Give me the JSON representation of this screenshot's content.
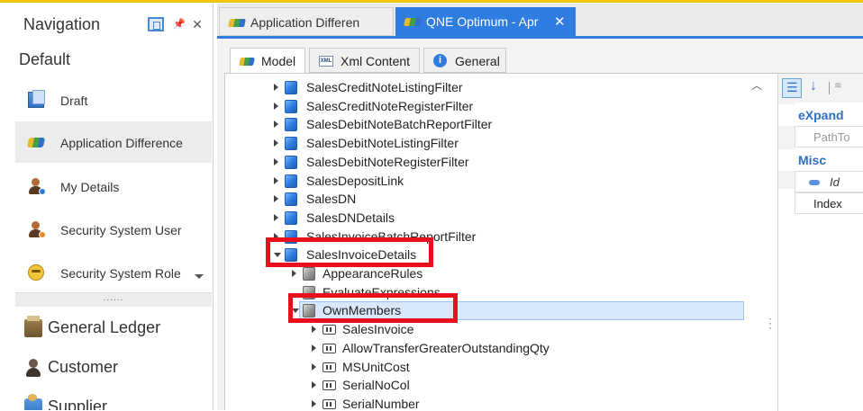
{
  "navigation": {
    "title": "Navigation",
    "group": "Default",
    "items": [
      {
        "label": "Draft",
        "icon": "draft-icon"
      },
      {
        "label": "Application Difference",
        "icon": "application-difference-icon",
        "selected": true
      },
      {
        "label": "My Details",
        "icon": "my-details-icon"
      },
      {
        "label": "Security System User",
        "icon": "security-user-icon"
      },
      {
        "label": "Security System Role",
        "icon": "security-role-icon"
      }
    ],
    "splitter": "......",
    "modules": [
      {
        "label": "General Ledger",
        "icon": "general-ledger-icon"
      },
      {
        "label": "Customer",
        "icon": "customer-icon"
      },
      {
        "label": "Supplier",
        "icon": "supplier-icon"
      }
    ]
  },
  "document_tabs": [
    {
      "label": "Application Differen",
      "active": false
    },
    {
      "label": "QNE Optimum - Apr",
      "active": true,
      "close": "✕"
    }
  ],
  "inner_tabs": [
    {
      "label": "Model",
      "selected": true
    },
    {
      "label": "Xml Content",
      "selected": false
    },
    {
      "label": "General",
      "selected": false
    }
  ],
  "tree": [
    {
      "label": "SalesCreditNoteListingFilter",
      "level": 0,
      "arrow": "right",
      "icon": "cube-blue"
    },
    {
      "label": "SalesCreditNoteRegisterFilter",
      "level": 0,
      "arrow": "right",
      "icon": "cube-blue"
    },
    {
      "label": "SalesDebitNoteBatchReportFilter",
      "level": 0,
      "arrow": "right",
      "icon": "cube-blue"
    },
    {
      "label": "SalesDebitNoteListingFilter",
      "level": 0,
      "arrow": "right",
      "icon": "cube-blue"
    },
    {
      "label": "SalesDebitNoteRegisterFilter",
      "level": 0,
      "arrow": "right",
      "icon": "cube-blue"
    },
    {
      "label": "SalesDepositLink",
      "level": 0,
      "arrow": "right",
      "icon": "cube-blue"
    },
    {
      "label": "SalesDN",
      "level": 0,
      "arrow": "right",
      "icon": "cube-blue"
    },
    {
      "label": "SalesDNDetails",
      "level": 0,
      "arrow": "right",
      "icon": "cube-blue"
    },
    {
      "label": "SalesInvoiceBatchReportFilter",
      "level": 0,
      "arrow": "right",
      "icon": "cube-blue"
    },
    {
      "label": "SalesInvoiceDetails",
      "level": 0,
      "arrow": "down",
      "icon": "cube-blue",
      "highlighted": true
    },
    {
      "label": "AppearanceRules",
      "level": 1,
      "arrow": "right",
      "icon": "cube-gray"
    },
    {
      "label": "EvaluateExpressions",
      "level": 1,
      "arrow": "none",
      "icon": "cube-gray"
    },
    {
      "label": "OwnMembers",
      "level": 1,
      "arrow": "down",
      "icon": "cube-gray",
      "highlighted": true,
      "selected": true
    },
    {
      "label": "SalesInvoice",
      "level": 2,
      "arrow": "right",
      "icon": "property"
    },
    {
      "label": "AllowTransferGreaterOutstandingQty",
      "level": 2,
      "arrow": "right",
      "icon": "property"
    },
    {
      "label": "MSUnitCost",
      "level": 2,
      "arrow": "right",
      "icon": "property"
    },
    {
      "label": "SerialNoCol",
      "level": 2,
      "arrow": "right",
      "icon": "property"
    },
    {
      "label": "SerialNumber",
      "level": 2,
      "arrow": "right",
      "icon": "property"
    }
  ],
  "highlight_color": "#e8101c",
  "accent_color": "#2f7de0",
  "property_grid": {
    "categories": [
      {
        "label": "eXpand",
        "rows": [
          {
            "value": "PathTo",
            "hint": true
          }
        ]
      },
      {
        "label": "Misc",
        "rows": [
          {
            "value": "Id",
            "italic": true,
            "key": true
          },
          {
            "value": "Index"
          }
        ]
      }
    ]
  }
}
